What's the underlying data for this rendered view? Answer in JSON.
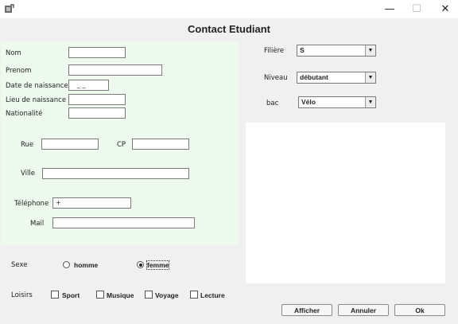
{
  "window": {
    "minimize_glyph": "—",
    "maximize_glyph": "☐",
    "close_glyph": "✕"
  },
  "heading": "Contact Etudiant",
  "identity": {
    "nom_label": "Nom",
    "prenom_label": "Prenom",
    "date_label": "Date de naissance",
    "date_value": "_ _",
    "lieu_label": "Lieu de naissance",
    "nationalite_label": "Nationalité"
  },
  "address": {
    "rue_label": "Rue",
    "cp_label": "CP",
    "ville_label": "Ville",
    "telephone_label": "Téléphone",
    "telephone_value": "+",
    "mail_label": "Mail"
  },
  "study": {
    "filiere_label": "Filière",
    "filiere_value": "S",
    "niveau_label": "Niveau",
    "niveau_value": "débutant",
    "bac_label": "bac",
    "bac_value": "Vélo"
  },
  "sexe": {
    "label": "Sexe",
    "options": [
      "homme",
      "femme"
    ],
    "selected": "femme"
  },
  "loisirs": {
    "label": "Loisirs",
    "options": [
      "Sport",
      "Musique",
      "Voyage",
      "Lecture"
    ]
  },
  "buttons": {
    "afficher": "Afficher",
    "annuler": "Annuler",
    "ok": "Ok"
  }
}
